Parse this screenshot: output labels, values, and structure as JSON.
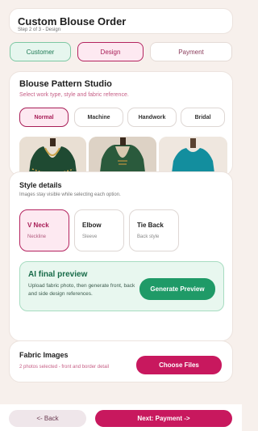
{
  "header": {
    "title": "Custom Blouse Order",
    "step": "Step 2 of 3 - Design"
  },
  "tabs": [
    {
      "label": "Customer",
      "state": "done"
    },
    {
      "label": "Design",
      "state": "active"
    },
    {
      "label": "Payment",
      "state": "pending"
    }
  ],
  "studio": {
    "title": "Blouse Pattern Studio",
    "subtitle": "Select work type, style and fabric reference.",
    "work_types": [
      "Normal",
      "Machine",
      "Handwork",
      "Bridal"
    ],
    "selected_work_type": "Normal"
  },
  "style_details": {
    "title": "Style details",
    "subtitle": "Images stay visible while selecting each option.",
    "options": [
      {
        "name": "V Neck",
        "detail": "Neckline",
        "selected": true
      },
      {
        "name": "Elbow",
        "detail": "Sleeve",
        "selected": false
      },
      {
        "name": "Tie Back",
        "detail": "Back style",
        "selected": false
      }
    ],
    "ai_preview": {
      "title": "AI final preview",
      "text": "Upload fabric photo, then generate front, back and side design references.",
      "button": "Generate Preview"
    }
  },
  "fabric": {
    "title": "Fabric Images",
    "status": "2 photos selected - front and border detail",
    "button": "Choose Files"
  },
  "footer": {
    "back": "<- Back",
    "next": "Next: Payment ->"
  },
  "colors": {
    "accent": "#c8185e",
    "success": "#1f9a67",
    "background": "#f7f0ec"
  }
}
